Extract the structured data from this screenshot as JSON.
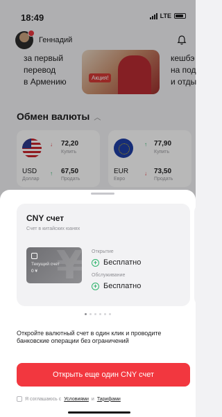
{
  "status_bar": {
    "time": "18:49",
    "network": "LTE"
  },
  "header": {
    "user_name": "Геннадий"
  },
  "promo": {
    "left_text": [
      "за первый",
      "перевод",
      "в Армению"
    ],
    "badge": "Акция!",
    "right_text": [
      "кешбэ",
      "на под",
      "и отды"
    ]
  },
  "exchange": {
    "title": "Обмен валюты",
    "rates": [
      {
        "code": "USD",
        "name": "Доллар",
        "buy": "72,20",
        "buy_label": "Купить",
        "sell": "67,50",
        "sell_label": "Продать"
      },
      {
        "code": "EUR",
        "name": "Евро",
        "buy": "77,90",
        "buy_label": "Купить",
        "sell": "73,50",
        "sell_label": "Продать"
      }
    ]
  },
  "sheet": {
    "card": {
      "title": "CNY счет",
      "subtitle": "Счет в китайских юанях",
      "mini_label": "Текущий счет",
      "mini_balance": "0 ¥",
      "mini_glyph": "¥",
      "open_label": "Открытие",
      "open_value": "Бесплатно",
      "service_label": "Обслуживание",
      "service_value": "Бесплатно"
    },
    "pager": {
      "count": 6,
      "active": 1
    },
    "description": "Откройте валютный счет в один клик и проводите банковские операции без ограничений",
    "cta_label": "Открыть еще один CNY счет",
    "agree_prefix": "Я соглашаюсь с",
    "agree_link1": "Условиями",
    "agree_and": "и",
    "agree_link2": "Тарифами"
  },
  "colors": {
    "accent": "#f2373f",
    "positive": "#2bb36a",
    "negative": "#e8373f"
  },
  "icons": {
    "notifications": "bell-icon",
    "collapse": "chevron-up-icon",
    "feature": "plus-circle-icon"
  }
}
